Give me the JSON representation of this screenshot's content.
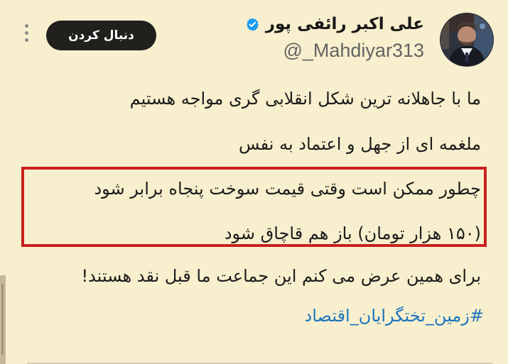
{
  "profile": {
    "name": "علی اکبر رائفی پور",
    "handle": "@_Mahdiyar313",
    "avatar_icon": "user-avatar",
    "verified_icon": "verified-badge-icon"
  },
  "actions": {
    "follow_label": "دنبال کردن",
    "more_icon": "more-options-icon"
  },
  "tweet": {
    "lines": [
      "ما با جاهلانه ترین شکل انقلابی گری مواجه هستیم",
      "ملغمه ای از جهل و اعتماد به نفس",
      "چطور ممکن است وقتی قیمت سوخت پنجاه برابر شود",
      "(۱۵۰ هزار تومان) باز هم قاچاق شود",
      "برای همین عرض می کنم این جماعت ما قبل نقد هستند!"
    ],
    "hashtag": "#زمین_تختگرایان_اقتصاد"
  },
  "colors": {
    "background": "#f7efcd",
    "highlight": "#c9201f",
    "hashtag": "#1d75bf",
    "button": "#21201d"
  }
}
